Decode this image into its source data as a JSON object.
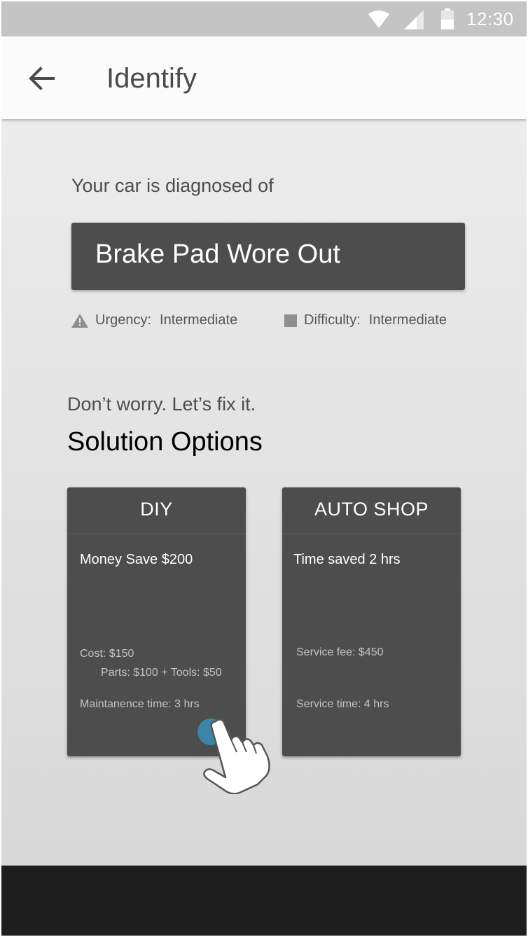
{
  "status_bar": {
    "time": "12:30",
    "icons": [
      "wifi-icon",
      "signal-icon",
      "battery-icon"
    ]
  },
  "app_bar": {
    "title": "Identify",
    "back_icon": "arrow-back-icon"
  },
  "diagnosis": {
    "intro": "Your car is diagnosed of",
    "result": "Brake Pad Wore Out",
    "urgency": {
      "label": "Urgency:",
      "value": "Intermediate",
      "icon": "warning-icon"
    },
    "difficulty": {
      "label": "Difficulty:",
      "value": "Intermediate",
      "icon": "square-icon"
    }
  },
  "solutions": {
    "reassurance": "Don’t worry. Let’s fix it.",
    "title": "Solution Options",
    "diy": {
      "header": "DIY",
      "headline": "Money Save $200",
      "cost": "Cost: $150",
      "cost_breakdown": "Parts: $100 + Tools: $50",
      "time": "Maintanence time: 3 hrs"
    },
    "shop": {
      "header": "AUTO SHOP",
      "headline": "Time saved 2 hrs",
      "fee": "Service fee: $450",
      "time": "Service time: 4 hrs"
    }
  },
  "colors": {
    "status_bar": "#c4c4c4",
    "app_bar": "#fbfbfb",
    "card": "#4d4d4d",
    "touch_indicator": "#3b85a8",
    "nav_bar": "#1e1e1e"
  }
}
